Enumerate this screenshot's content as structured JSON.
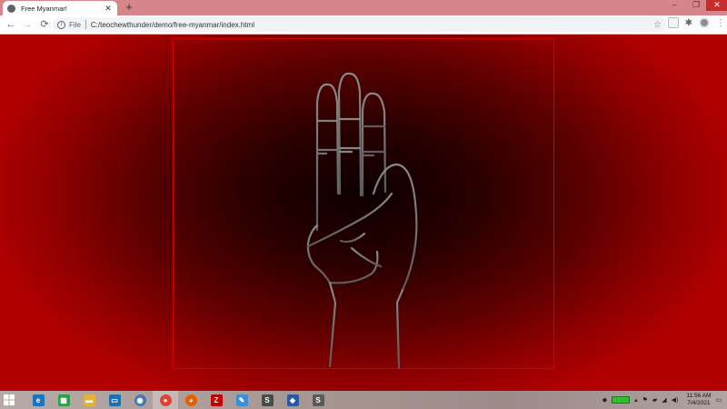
{
  "browser": {
    "tab_title": "Free Myanmar!",
    "address": {
      "scheme_label": "File",
      "url": "C:/teochewthunder/demo/free-myanmar/index.html"
    }
  },
  "taskbar": {
    "apps": [
      {
        "name": "internet-explorer-icon",
        "color": "#1c75bc"
      },
      {
        "name": "store-icon",
        "color": "#2f9e44"
      },
      {
        "name": "file-explorer-icon",
        "color": "#e2b33c"
      },
      {
        "name": "remote-desktop-icon",
        "color": "#1f6fb0"
      },
      {
        "name": "network-globe-icon",
        "color": "#4a78b5"
      },
      {
        "name": "chrome-icon",
        "color": "#db4437"
      },
      {
        "name": "firefox-icon",
        "color": "#e66000"
      },
      {
        "name": "filezilla-icon",
        "color": "#bf0000"
      },
      {
        "name": "notepad-icon",
        "color": "#3d8fd1"
      },
      {
        "name": "sublime-text-icon",
        "color": "#4a4a4a"
      },
      {
        "name": "vpn-shield-icon",
        "color": "#2c5aa0"
      },
      {
        "name": "sublime-merge-icon",
        "color": "#5a5a5a"
      }
    ],
    "clock": {
      "time": "11:56 AM",
      "date": "7/4/2021"
    }
  }
}
